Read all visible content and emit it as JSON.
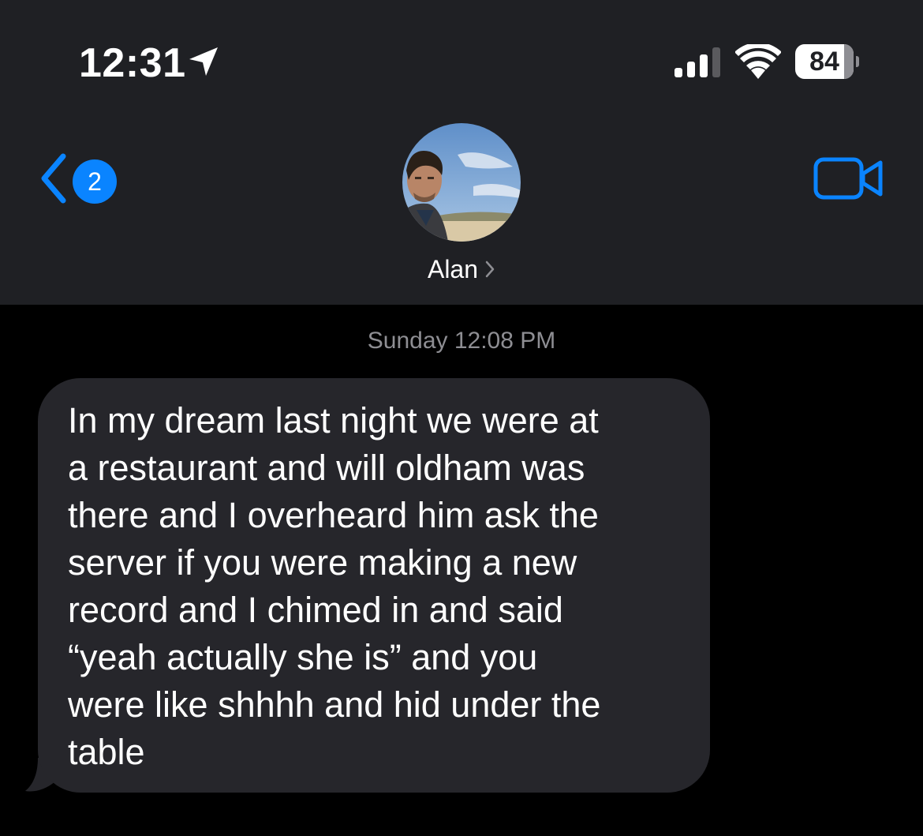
{
  "status_bar": {
    "time": "12:31",
    "location_icon": "location-arrow-icon",
    "signal_icon": "cellular-signal-icon",
    "signal_bars": 3,
    "signal_bars_total": 4,
    "wifi_icon": "wifi-icon",
    "battery_percent": "84",
    "battery_level": 0.84
  },
  "nav": {
    "back_icon": "chevron-left-icon",
    "unread_count": "2",
    "contact_name": "Alan",
    "contact_chevron_icon": "chevron-right-icon",
    "video_icon": "video-camera-icon"
  },
  "conversation": {
    "timestamp": "Sunday 12:08 PM",
    "messages": [
      {
        "direction": "incoming",
        "text": "In my dream last night we were at\na restaurant and will oldham was\nthere and I overheard him ask the\nserver if you were making a new\nrecord and I chimed in and said\n“yeah actually she is” and you\nwere like shhhh and hid under the\ntable"
      }
    ]
  },
  "colors": {
    "header_bg": "#1f2024",
    "background": "#000000",
    "accent": "#0a84ff",
    "incoming_bubble": "#26262b",
    "secondary_text": "#8e8e93"
  }
}
